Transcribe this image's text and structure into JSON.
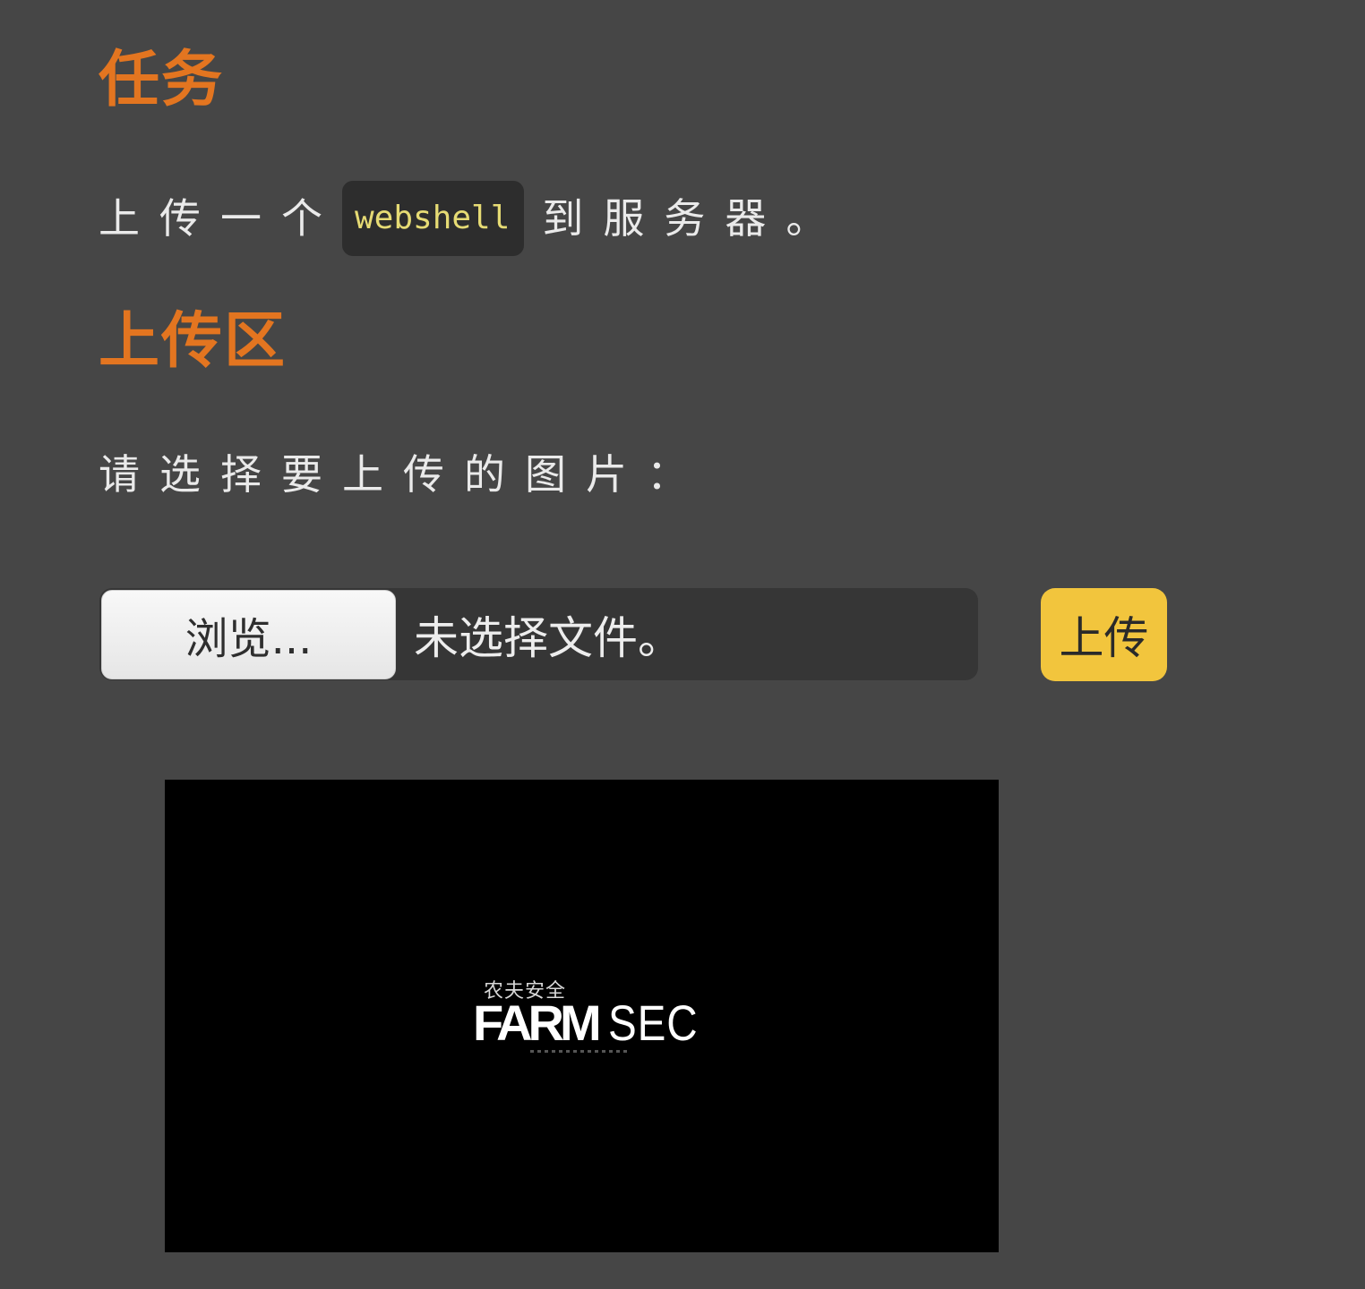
{
  "sections": {
    "task_heading": "任务",
    "upload_heading": "上传区"
  },
  "task": {
    "text_before": "上传一个",
    "code": "webshell",
    "text_after": "到服务器。"
  },
  "upload": {
    "prompt": "请选择要上传的图片：",
    "browse_label": "浏览...",
    "file_status": "未选择文件。",
    "submit_label": "上传"
  },
  "preview": {
    "logo_cn": "农夫安全",
    "logo_farm": "FARM",
    "logo_sec": "SEC"
  },
  "colors": {
    "background": "#464646",
    "heading": "#e37520",
    "code_text": "#e6db74",
    "upload_button": "#f2c53d"
  }
}
